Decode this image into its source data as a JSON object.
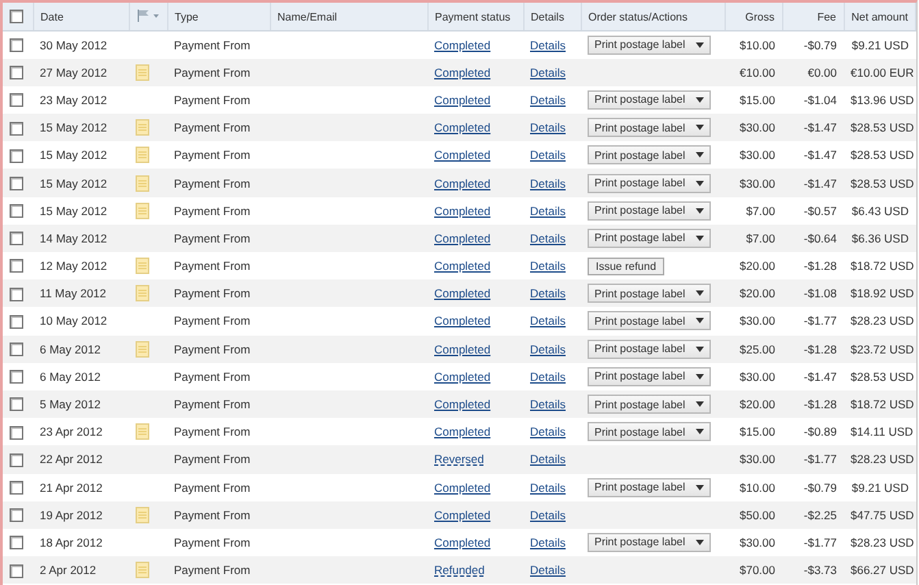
{
  "header": {
    "checked": false,
    "columns": [
      "Date",
      "Type",
      "Name/Email",
      "Payment status",
      "Details",
      "Order status/Actions",
      "Gross",
      "Fee",
      "Net amount"
    ]
  },
  "rows": [
    {
      "checked": false,
      "date": "30 May 2012",
      "note": false,
      "type": "Payment From",
      "status": {
        "text": "Completed",
        "kind": "solid"
      },
      "details": "Details",
      "action": {
        "kind": "dropdown",
        "label": "Print postage label"
      },
      "gross": "$10.00",
      "fee": "-$0.79",
      "net": "$9.21 USD"
    },
    {
      "checked": false,
      "date": "27 May 2012",
      "note": true,
      "type": "Payment From",
      "status": {
        "text": "Completed",
        "kind": "solid"
      },
      "details": "Details",
      "action": {
        "kind": "none"
      },
      "gross": "€10.00",
      "fee": "€0.00",
      "net": "€10.00 EUR"
    },
    {
      "checked": false,
      "date": "23 May 2012",
      "note": false,
      "type": "Payment From",
      "status": {
        "text": "Completed",
        "kind": "solid"
      },
      "details": "Details",
      "action": {
        "kind": "dropdown",
        "label": "Print postage label"
      },
      "gross": "$15.00",
      "fee": "-$1.04",
      "net": "$13.96 USD"
    },
    {
      "checked": false,
      "date": "15 May 2012",
      "note": true,
      "type": "Payment From",
      "status": {
        "text": "Completed",
        "kind": "solid"
      },
      "details": "Details",
      "action": {
        "kind": "dropdown",
        "label": "Print postage label"
      },
      "gross": "$30.00",
      "fee": "-$1.47",
      "net": "$28.53 USD"
    },
    {
      "checked": false,
      "date": "15 May 2012",
      "note": true,
      "type": "Payment From",
      "status": {
        "text": "Completed",
        "kind": "solid"
      },
      "details": "Details",
      "action": {
        "kind": "dropdown",
        "label": "Print postage label"
      },
      "gross": "$30.00",
      "fee": "-$1.47",
      "net": "$28.53 USD"
    },
    {
      "checked": false,
      "date": "15 May 2012",
      "note": true,
      "type": "Payment From",
      "status": {
        "text": "Completed",
        "kind": "solid"
      },
      "details": "Details",
      "action": {
        "kind": "dropdown",
        "label": "Print postage label"
      },
      "gross": "$30.00",
      "fee": "-$1.47",
      "net": "$28.53 USD"
    },
    {
      "checked": false,
      "date": "15 May 2012",
      "note": true,
      "type": "Payment From",
      "status": {
        "text": "Completed",
        "kind": "solid"
      },
      "details": "Details",
      "action": {
        "kind": "dropdown",
        "label": "Print postage label"
      },
      "gross": "$7.00",
      "fee": "-$0.57",
      "net": "$6.43 USD"
    },
    {
      "checked": false,
      "date": "14 May 2012",
      "note": false,
      "type": "Payment From",
      "status": {
        "text": "Completed",
        "kind": "solid"
      },
      "details": "Details",
      "action": {
        "kind": "dropdown",
        "label": "Print postage label"
      },
      "gross": "$7.00",
      "fee": "-$0.64",
      "net": "$6.36 USD"
    },
    {
      "checked": false,
      "date": "12 May 2012",
      "note": true,
      "type": "Payment From",
      "status": {
        "text": "Completed",
        "kind": "solid"
      },
      "details": "Details",
      "action": {
        "kind": "button",
        "label": "Issue refund"
      },
      "gross": "$20.00",
      "fee": "-$1.28",
      "net": "$18.72 USD"
    },
    {
      "checked": false,
      "date": "11 May 2012",
      "note": true,
      "type": "Payment From",
      "status": {
        "text": "Completed",
        "kind": "solid"
      },
      "details": "Details",
      "action": {
        "kind": "dropdown",
        "label": "Print postage label"
      },
      "gross": "$20.00",
      "fee": "-$1.08",
      "net": "$18.92 USD"
    },
    {
      "checked": false,
      "date": "10 May 2012",
      "note": false,
      "type": "Payment From",
      "status": {
        "text": "Completed",
        "kind": "solid"
      },
      "details": "Details",
      "action": {
        "kind": "dropdown",
        "label": "Print postage label"
      },
      "gross": "$30.00",
      "fee": "-$1.77",
      "net": "$28.23 USD"
    },
    {
      "checked": false,
      "date": "6 May 2012",
      "note": true,
      "type": "Payment From",
      "status": {
        "text": "Completed",
        "kind": "solid"
      },
      "details": "Details",
      "action": {
        "kind": "dropdown",
        "label": "Print postage label"
      },
      "gross": "$25.00",
      "fee": "-$1.28",
      "net": "$23.72 USD"
    },
    {
      "checked": false,
      "date": "6 May 2012",
      "note": false,
      "type": "Payment From",
      "status": {
        "text": "Completed",
        "kind": "solid"
      },
      "details": "Details",
      "action": {
        "kind": "dropdown",
        "label": "Print postage label"
      },
      "gross": "$30.00",
      "fee": "-$1.47",
      "net": "$28.53 USD"
    },
    {
      "checked": false,
      "date": "5 May 2012",
      "note": false,
      "type": "Payment From",
      "status": {
        "text": "Completed",
        "kind": "solid"
      },
      "details": "Details",
      "action": {
        "kind": "dropdown",
        "label": "Print postage label"
      },
      "gross": "$20.00",
      "fee": "-$1.28",
      "net": "$18.72 USD"
    },
    {
      "checked": false,
      "date": "23 Apr 2012",
      "note": true,
      "type": "Payment From",
      "status": {
        "text": "Completed",
        "kind": "solid"
      },
      "details": "Details",
      "action": {
        "kind": "dropdown",
        "label": "Print postage label"
      },
      "gross": "$15.00",
      "fee": "-$0.89",
      "net": "$14.11 USD"
    },
    {
      "checked": false,
      "date": "22 Apr 2012",
      "note": false,
      "type": "Payment From",
      "status": {
        "text": "Reversed",
        "kind": "dashed"
      },
      "details": "Details",
      "action": {
        "kind": "none"
      },
      "gross": "$30.00",
      "fee": "-$1.77",
      "net": "$28.23 USD"
    },
    {
      "checked": false,
      "date": "21 Apr 2012",
      "note": false,
      "type": "Payment From",
      "status": {
        "text": "Completed",
        "kind": "solid"
      },
      "details": "Details",
      "action": {
        "kind": "dropdown",
        "label": "Print postage label"
      },
      "gross": "$10.00",
      "fee": "-$0.79",
      "net": "$9.21 USD"
    },
    {
      "checked": false,
      "date": "19 Apr 2012",
      "note": true,
      "type": "Payment From",
      "status": {
        "text": "Completed",
        "kind": "solid"
      },
      "details": "Details",
      "action": {
        "kind": "none"
      },
      "gross": "$50.00",
      "fee": "-$2.25",
      "net": "$47.75 USD"
    },
    {
      "checked": false,
      "date": "18 Apr 2012",
      "note": false,
      "type": "Payment From",
      "status": {
        "text": "Completed",
        "kind": "solid"
      },
      "details": "Details",
      "action": {
        "kind": "dropdown",
        "label": "Print postage label"
      },
      "gross": "$30.00",
      "fee": "-$1.77",
      "net": "$28.23 USD"
    },
    {
      "checked": false,
      "date": "2 Apr 2012",
      "note": true,
      "type": "Payment From",
      "status": {
        "text": "Refunded",
        "kind": "dashed"
      },
      "details": "Details",
      "action": {
        "kind": "none"
      },
      "gross": "$70.00",
      "fee": "-$3.73",
      "net": "$66.27 USD"
    }
  ]
}
